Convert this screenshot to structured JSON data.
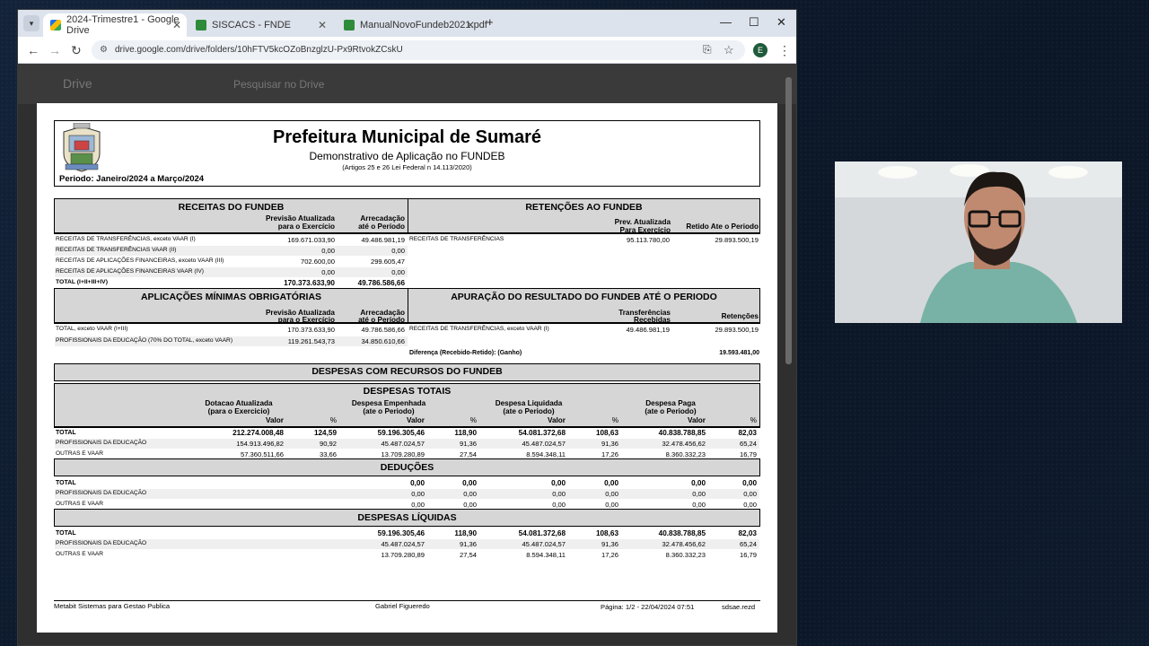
{
  "browser": {
    "tabs": [
      {
        "label": "2024-Trimestre1 - Google Drive",
        "active": true
      },
      {
        "label": "SISCACS - FNDE",
        "active": false
      },
      {
        "label": "ManualNovoFundeb2021.pdf",
        "active": false
      }
    ],
    "url": "drive.google.com/drive/folders/10hFTV5kcOZoBnzglzU-Px9RtvokZCskU",
    "profile_initial": "E",
    "drive_label": "Drive",
    "search_placeholder": "Pesquisar no Drive"
  },
  "doc": {
    "title": "Prefeitura Municipal de Sumaré",
    "subtitle": "Demonstrativo de Aplicação no FUNDEB",
    "law": "(Artigos 25 e 26 Lei Federal n 14.113/2020)",
    "period": "Periodo: Janeiro/2024 a Março/2024",
    "receitas": {
      "title": "RECEITAS DO FUNDEB",
      "col1": "Previsão Atualizada",
      "col1b": "para o Exercício",
      "col2": "Arrecadação",
      "col2b": "até o Período",
      "rows": [
        {
          "label": "RECEITAS DE TRANSFERÊNCIAS, exceto VAAR (I)",
          "v1": "169.671.033,90",
          "v2": "49.486.981,19"
        },
        {
          "label": "RECEITAS DE TRANSFERÊNCIAS VAAR (II)",
          "v1": "0,00",
          "v2": "0,00"
        },
        {
          "label": "RECEITAS DE APLICAÇÕES FINANCEIRAS, exceto VAAR (III)",
          "v1": "702.600,00",
          "v2": "299.605,47"
        },
        {
          "label": "RECEITAS DE APLICAÇÕES FINANCEIRAS  VAAR (IV)",
          "v1": "0,00",
          "v2": "0,00"
        },
        {
          "label": "TOTAL (I+II+III+IV)",
          "v1": "170.373.633,90",
          "v2": "49.786.586,66"
        }
      ]
    },
    "retencoes": {
      "title": "RETENÇÕES AO FUNDEB",
      "col1": "Prev. Atualizada",
      "col1b": "Para  Exercício",
      "col2": "Retido Ate o Periodo",
      "rows": [
        {
          "label": "RECEITAS DE TRANSFERÊNCIAS",
          "v1": "95.113.780,00",
          "v2": "29.893.500,19"
        }
      ]
    },
    "aplicacoes": {
      "title": "APLICAÇÕES MÍNIMAS OBRIGATÓRIAS",
      "col1": "Previsão Atualizada",
      "col1b": "para o Exercício",
      "col2": "Arrecadação",
      "col2b": "até o Período",
      "rows": [
        {
          "label": "TOTAL, exceto VAAR (I+III)",
          "v1": "170.373.633,90",
          "v2": "49.786.586,66"
        },
        {
          "label": "PROFISSIONAIS DA EDUCAÇÃO (70% DO TOTAL, exceto VAAR)",
          "v1": "119.261.543,73",
          "v2": "34.850.610,66"
        }
      ]
    },
    "apuracao": {
      "title": "APURAÇÃO DO RESULTADO DO FUNDEB ATÉ O PERIODO",
      "col1": "Transferências",
      "col1b": "Recebidas",
      "col2": "Retenções",
      "rows": [
        {
          "label": "RECEITAS DE TRANSFERÊNCIAS, exceto VAAR (I)",
          "v1": "49.486.981,19",
          "v2": "29.893.500,19"
        }
      ],
      "diff_label": "Diferença (Recebido-Retido): (Ganho)",
      "diff_value": "19.593.481,00"
    },
    "despesas": {
      "title": "DESPESAS COM RECURSOS DO FUNDEB",
      "sub": "DESPESAS TOTAIS",
      "groups": [
        {
          "l1": "Dotacao Atualizada",
          "l2": "(para o Exercicio)",
          "v": "Valor",
          "p": "%"
        },
        {
          "l1": "Despesa Empenhada",
          "l2": "(ate o Periodo)",
          "v": "Valor",
          "p": "%"
        },
        {
          "l1": "Despesa Liquidada",
          "l2": "(ate o Periodo)",
          "v": "Valor",
          "p": "%"
        },
        {
          "l1": "Despesa Paga",
          "l2": "(ate o Periodo)",
          "v": "Valor",
          "p": "%"
        }
      ],
      "rows": [
        {
          "label": "TOTAL",
          "vals": [
            "212.274.008,48",
            "124,59",
            "59.196.305,46",
            "118,90",
            "54.081.372,68",
            "108,63",
            "40.838.788,85",
            "82,03"
          ]
        },
        {
          "label": "PROFISSIONAIS DA EDUCAÇÃO",
          "vals": [
            "154.913.496,82",
            "90,92",
            "45.487.024,57",
            "91,36",
            "45.487.024,57",
            "91,36",
            "32.478.456,62",
            "65,24"
          ]
        },
        {
          "label": "OUTRAS E VAAR",
          "vals": [
            "57.360.511,66",
            "33,66",
            "13.709.280,89",
            "27,54",
            "8.594.348,11",
            "17,26",
            "8.360.332,23",
            "16,79"
          ]
        }
      ]
    },
    "deducoes": {
      "title": "DEDUÇÕES",
      "rows": [
        {
          "label": "TOTAL",
          "vals": [
            "0,00",
            "0,00",
            "0,00",
            "0,00",
            "0,00",
            "0,00"
          ]
        },
        {
          "label": "PROFISSIONAIS DA EDUCAÇÃO",
          "vals": [
            "0,00",
            "0,00",
            "0,00",
            "0,00",
            "0,00",
            "0,00"
          ]
        },
        {
          "label": "OUTRAS E VAAR",
          "vals": [
            "0,00",
            "0,00",
            "0,00",
            "0,00",
            "0,00",
            "0,00"
          ]
        }
      ]
    },
    "liquidas": {
      "title": "DESPESAS LÍQUIDAS",
      "rows": [
        {
          "label": "TOTAL",
          "vals": [
            "59.196.305,46",
            "118,90",
            "54.081.372,68",
            "108,63",
            "40.838.788,85",
            "82,03"
          ]
        },
        {
          "label": "PROFISSIONAIS DA EDUCAÇÃO",
          "vals": [
            "45.487.024,57",
            "91,36",
            "45.487.024,57",
            "91,36",
            "32.478.456,62",
            "65,24"
          ]
        },
        {
          "label": "OUTRAS E VAAR",
          "vals": [
            "13.709.280,89",
            "27,54",
            "8.594.348,11",
            "17,26",
            "8.360.332,23",
            "16,79"
          ]
        }
      ]
    },
    "footer": {
      "left": "Metabit Sistemas para Gestao Publica",
      "center": "Gabriel Figueredo",
      "right": "Página: 1/2 - 22/04/2024 07:51",
      "code": "sdsae.rezd"
    }
  },
  "colors": {
    "tab_bar": "#dde3ec",
    "header_shade": "#d6d6d6",
    "viewer_bg": "#2f2f2f",
    "page_bg": "#ffffff"
  },
  "icons": [
    "tab-dropdown-icon",
    "drive-favicon",
    "close-icon",
    "new-tab-icon",
    "minimize-icon",
    "maximize-icon",
    "back-icon",
    "forward-icon",
    "reload-icon",
    "site-settings-icon",
    "install-icon",
    "star-icon",
    "menu-icon",
    "crest-icon"
  ]
}
